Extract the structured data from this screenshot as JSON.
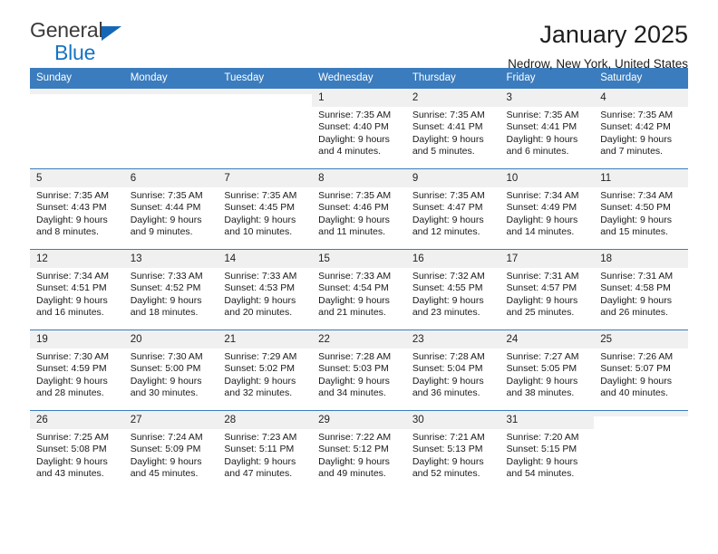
{
  "brand": {
    "line1": "General",
    "line2": "Blue",
    "triangle_icon": "triangle-icon",
    "accent_color": "#1773c4"
  },
  "header": {
    "title": "January 2025",
    "subtitle": "Nedrow, New York, United States"
  },
  "theme": {
    "header_bg": "#3a7cbe",
    "header_text": "#ffffff",
    "daynum_bg": "#f0f0f0",
    "row_border": "#3a7cbe"
  },
  "calendar": {
    "weekday_headers": [
      "Sunday",
      "Monday",
      "Tuesday",
      "Wednesday",
      "Thursday",
      "Friday",
      "Saturday"
    ],
    "weeks": [
      [
        {
          "day": "",
          "empty": true
        },
        {
          "day": "",
          "empty": true
        },
        {
          "day": "",
          "empty": true
        },
        {
          "day": "1",
          "sunrise": "Sunrise: 7:35 AM",
          "sunset": "Sunset: 4:40 PM",
          "daylight_line1": "Daylight: 9 hours",
          "daylight_line2": "and 4 minutes."
        },
        {
          "day": "2",
          "sunrise": "Sunrise: 7:35 AM",
          "sunset": "Sunset: 4:41 PM",
          "daylight_line1": "Daylight: 9 hours",
          "daylight_line2": "and 5 minutes."
        },
        {
          "day": "3",
          "sunrise": "Sunrise: 7:35 AM",
          "sunset": "Sunset: 4:41 PM",
          "daylight_line1": "Daylight: 9 hours",
          "daylight_line2": "and 6 minutes."
        },
        {
          "day": "4",
          "sunrise": "Sunrise: 7:35 AM",
          "sunset": "Sunset: 4:42 PM",
          "daylight_line1": "Daylight: 9 hours",
          "daylight_line2": "and 7 minutes."
        }
      ],
      [
        {
          "day": "5",
          "sunrise": "Sunrise: 7:35 AM",
          "sunset": "Sunset: 4:43 PM",
          "daylight_line1": "Daylight: 9 hours",
          "daylight_line2": "and 8 minutes."
        },
        {
          "day": "6",
          "sunrise": "Sunrise: 7:35 AM",
          "sunset": "Sunset: 4:44 PM",
          "daylight_line1": "Daylight: 9 hours",
          "daylight_line2": "and 9 minutes."
        },
        {
          "day": "7",
          "sunrise": "Sunrise: 7:35 AM",
          "sunset": "Sunset: 4:45 PM",
          "daylight_line1": "Daylight: 9 hours",
          "daylight_line2": "and 10 minutes."
        },
        {
          "day": "8",
          "sunrise": "Sunrise: 7:35 AM",
          "sunset": "Sunset: 4:46 PM",
          "daylight_line1": "Daylight: 9 hours",
          "daylight_line2": "and 11 minutes."
        },
        {
          "day": "9",
          "sunrise": "Sunrise: 7:35 AM",
          "sunset": "Sunset: 4:47 PM",
          "daylight_line1": "Daylight: 9 hours",
          "daylight_line2": "and 12 minutes."
        },
        {
          "day": "10",
          "sunrise": "Sunrise: 7:34 AM",
          "sunset": "Sunset: 4:49 PM",
          "daylight_line1": "Daylight: 9 hours",
          "daylight_line2": "and 14 minutes."
        },
        {
          "day": "11",
          "sunrise": "Sunrise: 7:34 AM",
          "sunset": "Sunset: 4:50 PM",
          "daylight_line1": "Daylight: 9 hours",
          "daylight_line2": "and 15 minutes."
        }
      ],
      [
        {
          "day": "12",
          "sunrise": "Sunrise: 7:34 AM",
          "sunset": "Sunset: 4:51 PM",
          "daylight_line1": "Daylight: 9 hours",
          "daylight_line2": "and 16 minutes."
        },
        {
          "day": "13",
          "sunrise": "Sunrise: 7:33 AM",
          "sunset": "Sunset: 4:52 PM",
          "daylight_line1": "Daylight: 9 hours",
          "daylight_line2": "and 18 minutes."
        },
        {
          "day": "14",
          "sunrise": "Sunrise: 7:33 AM",
          "sunset": "Sunset: 4:53 PM",
          "daylight_line1": "Daylight: 9 hours",
          "daylight_line2": "and 20 minutes."
        },
        {
          "day": "15",
          "sunrise": "Sunrise: 7:33 AM",
          "sunset": "Sunset: 4:54 PM",
          "daylight_line1": "Daylight: 9 hours",
          "daylight_line2": "and 21 minutes."
        },
        {
          "day": "16",
          "sunrise": "Sunrise: 7:32 AM",
          "sunset": "Sunset: 4:55 PM",
          "daylight_line1": "Daylight: 9 hours",
          "daylight_line2": "and 23 minutes."
        },
        {
          "day": "17",
          "sunrise": "Sunrise: 7:31 AM",
          "sunset": "Sunset: 4:57 PM",
          "daylight_line1": "Daylight: 9 hours",
          "daylight_line2": "and 25 minutes."
        },
        {
          "day": "18",
          "sunrise": "Sunrise: 7:31 AM",
          "sunset": "Sunset: 4:58 PM",
          "daylight_line1": "Daylight: 9 hours",
          "daylight_line2": "and 26 minutes."
        }
      ],
      [
        {
          "day": "19",
          "sunrise": "Sunrise: 7:30 AM",
          "sunset": "Sunset: 4:59 PM",
          "daylight_line1": "Daylight: 9 hours",
          "daylight_line2": "and 28 minutes."
        },
        {
          "day": "20",
          "sunrise": "Sunrise: 7:30 AM",
          "sunset": "Sunset: 5:00 PM",
          "daylight_line1": "Daylight: 9 hours",
          "daylight_line2": "and 30 minutes."
        },
        {
          "day": "21",
          "sunrise": "Sunrise: 7:29 AM",
          "sunset": "Sunset: 5:02 PM",
          "daylight_line1": "Daylight: 9 hours",
          "daylight_line2": "and 32 minutes."
        },
        {
          "day": "22",
          "sunrise": "Sunrise: 7:28 AM",
          "sunset": "Sunset: 5:03 PM",
          "daylight_line1": "Daylight: 9 hours",
          "daylight_line2": "and 34 minutes."
        },
        {
          "day": "23",
          "sunrise": "Sunrise: 7:28 AM",
          "sunset": "Sunset: 5:04 PM",
          "daylight_line1": "Daylight: 9 hours",
          "daylight_line2": "and 36 minutes."
        },
        {
          "day": "24",
          "sunrise": "Sunrise: 7:27 AM",
          "sunset": "Sunset: 5:05 PM",
          "daylight_line1": "Daylight: 9 hours",
          "daylight_line2": "and 38 minutes."
        },
        {
          "day": "25",
          "sunrise": "Sunrise: 7:26 AM",
          "sunset": "Sunset: 5:07 PM",
          "daylight_line1": "Daylight: 9 hours",
          "daylight_line2": "and 40 minutes."
        }
      ],
      [
        {
          "day": "26",
          "sunrise": "Sunrise: 7:25 AM",
          "sunset": "Sunset: 5:08 PM",
          "daylight_line1": "Daylight: 9 hours",
          "daylight_line2": "and 43 minutes."
        },
        {
          "day": "27",
          "sunrise": "Sunrise: 7:24 AM",
          "sunset": "Sunset: 5:09 PM",
          "daylight_line1": "Daylight: 9 hours",
          "daylight_line2": "and 45 minutes."
        },
        {
          "day": "28",
          "sunrise": "Sunrise: 7:23 AM",
          "sunset": "Sunset: 5:11 PM",
          "daylight_line1": "Daylight: 9 hours",
          "daylight_line2": "and 47 minutes."
        },
        {
          "day": "29",
          "sunrise": "Sunrise: 7:22 AM",
          "sunset": "Sunset: 5:12 PM",
          "daylight_line1": "Daylight: 9 hours",
          "daylight_line2": "and 49 minutes."
        },
        {
          "day": "30",
          "sunrise": "Sunrise: 7:21 AM",
          "sunset": "Sunset: 5:13 PM",
          "daylight_line1": "Daylight: 9 hours",
          "daylight_line2": "and 52 minutes."
        },
        {
          "day": "31",
          "sunrise": "Sunrise: 7:20 AM",
          "sunset": "Sunset: 5:15 PM",
          "daylight_line1": "Daylight: 9 hours",
          "daylight_line2": "and 54 minutes."
        },
        {
          "day": "",
          "empty": true
        }
      ]
    ]
  }
}
